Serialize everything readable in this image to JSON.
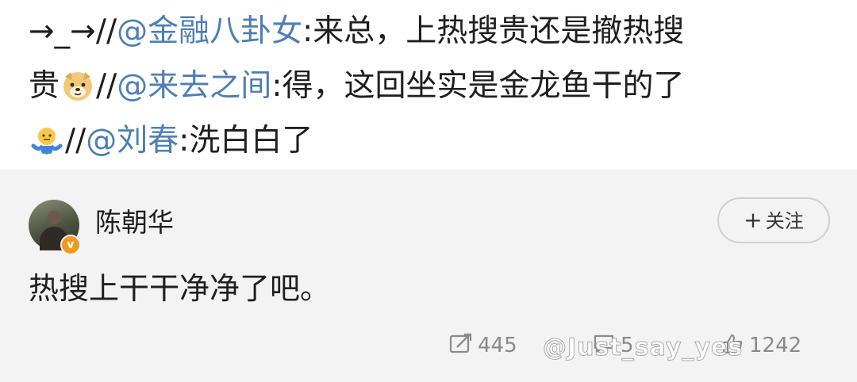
{
  "repost": {
    "line1_prefix": "→_→//",
    "line1_mention": "@金融八卦女",
    "line1_text": ":来总，上热搜贵还是撤热搜",
    "line2_text_start": "贵",
    "line2_emoji": "doge-emoji",
    "line2_sep": "//",
    "line2_mention": "@来去之间",
    "line2_text": ":得，这回坐实是金龙鱼干的了",
    "line3_emoji": "shrug-emoji",
    "line3_sep": "//",
    "line3_mention": "@刘春",
    "line3_text": ":洗白白了"
  },
  "comment": {
    "username": "陈朝华",
    "verified_badge": "v",
    "follow_label": "关注",
    "follow_plus": "+",
    "text": "热搜上干干净净了吧。",
    "reposts": "445",
    "comments": "5",
    "likes": "1242"
  },
  "watermark": {
    "text": "@Just_say_yes"
  },
  "colors": {
    "mention": "#4f7eb3",
    "card_bg": "#f3f3f3",
    "badge": "#f29a1c"
  }
}
